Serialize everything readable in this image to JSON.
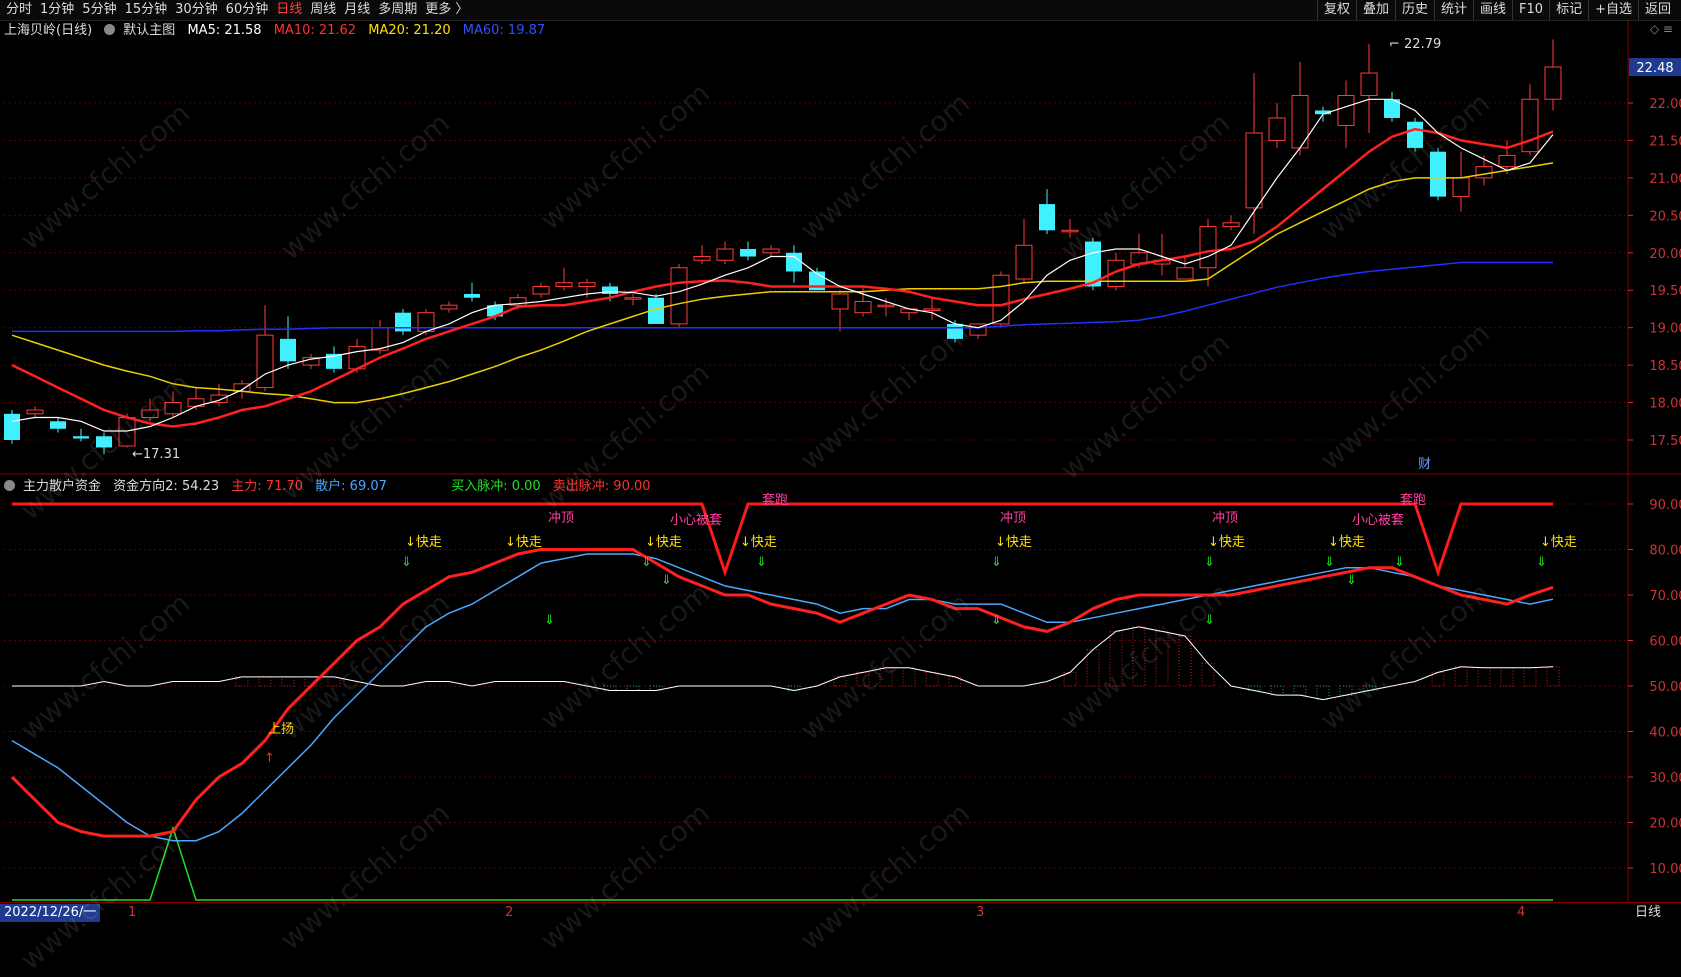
{
  "toolbar": {
    "left": [
      "分时",
      "1分钟",
      "5分钟",
      "15分钟",
      "30分钟",
      "60分钟",
      "日线",
      "周线",
      "月线",
      "多周期",
      "更多 〉"
    ],
    "active": "日线",
    "right": [
      "复权",
      "叠加",
      "历史",
      "统计",
      "画线",
      "F10",
      "标记",
      "+自选",
      "返回"
    ]
  },
  "legend_main": {
    "stock": "上海贝岭(日线)",
    "indicator": "默认主图",
    "ma5": "MA5: 21.58",
    "ma10": "MA10: 21.62",
    "ma20": "MA20: 21.20",
    "ma60": "MA60: 19.87"
  },
  "legend_sub": {
    "name": "主力散户资金",
    "dir": "资金方向2: 54.23",
    "main": "主力: 71.70",
    "retail": "散户: 69.07",
    "buy": "买入脉冲: 0.00",
    "sell": "卖出脉冲: 90.00"
  },
  "top_icons": "◇ ≡",
  "colors": {
    "up": "#ff3b3b",
    "down": "#40f0ff",
    "ma5": "#ffffff",
    "ma10": "#ff2020",
    "ma20": "#e8d000",
    "ma60": "#2030ff",
    "grid": "#5a0000",
    "axis": "#cc3333"
  },
  "price_axis": {
    "ticks": [
      "22.00",
      "21.50",
      "21.00",
      "20.50",
      "20.00",
      "19.50",
      "19.00",
      "18.50",
      "18.00",
      "17.50"
    ],
    "current": "22.48"
  },
  "sub_axis": {
    "ticks": [
      "90.00",
      "80.00",
      "70.00",
      "60.00",
      "50.00",
      "40.00",
      "30.00",
      "20.00",
      "10.00"
    ]
  },
  "annotations": {
    "high": "22.79",
    "low": "17.31",
    "fin": "财",
    "chongding": "冲顶",
    "xiaoxin": "小心被套",
    "taopao": "套跑",
    "kuaizou": "↓快走",
    "shangyang": "上扬"
  },
  "bottom": {
    "date": "2022/12/26/一",
    "months": [
      "1",
      "2",
      "3",
      "4"
    ],
    "period": "日线"
  },
  "watermark": "www.cfchi.com",
  "chart_data": {
    "type": "candlestick",
    "ylim": [
      17.2,
      22.9
    ],
    "candles": [
      [
        17.85,
        17.5,
        17.9,
        17.45
      ],
      [
        17.85,
        17.9,
        17.95,
        17.8
      ],
      [
        17.75,
        17.65,
        17.8,
        17.6
      ],
      [
        17.55,
        17.52,
        17.65,
        17.48
      ],
      [
        17.55,
        17.4,
        17.6,
        17.31
      ],
      [
        17.42,
        17.8,
        17.85,
        17.4
      ],
      [
        17.8,
        17.9,
        18.05,
        17.75
      ],
      [
        17.85,
        18.0,
        18.15,
        17.8
      ],
      [
        17.95,
        18.05,
        18.2,
        17.9
      ],
      [
        18.0,
        18.1,
        18.25,
        17.95
      ],
      [
        18.15,
        18.25,
        18.3,
        18.05
      ],
      [
        18.2,
        18.9,
        19.3,
        18.15
      ],
      [
        18.85,
        18.55,
        19.15,
        18.45
      ],
      [
        18.5,
        18.6,
        18.65,
        18.45
      ],
      [
        18.65,
        18.45,
        18.75,
        18.4
      ],
      [
        18.45,
        18.75,
        18.85,
        18.4
      ],
      [
        18.7,
        19.0,
        19.1,
        18.65
      ],
      [
        19.2,
        18.95,
        19.25,
        18.9
      ],
      [
        18.95,
        19.2,
        19.25,
        18.9
      ],
      [
        19.25,
        19.3,
        19.35,
        19.2
      ],
      [
        19.45,
        19.4,
        19.6,
        19.35
      ],
      [
        19.3,
        19.15,
        19.35,
        19.1
      ],
      [
        19.3,
        19.4,
        19.45,
        19.25
      ],
      [
        19.45,
        19.55,
        19.6,
        19.4
      ],
      [
        19.55,
        19.6,
        19.8,
        19.5
      ],
      [
        19.55,
        19.6,
        19.65,
        19.4
      ],
      [
        19.55,
        19.45,
        19.6,
        19.35
      ],
      [
        19.4,
        19.4,
        19.45,
        19.3
      ],
      [
        19.4,
        19.05,
        19.45,
        19.05
      ],
      [
        19.05,
        19.8,
        19.85,
        19.0
      ],
      [
        19.9,
        19.95,
        20.1,
        19.85
      ],
      [
        19.9,
        20.05,
        20.15,
        19.85
      ],
      [
        20.05,
        19.95,
        20.15,
        19.9
      ],
      [
        20.0,
        20.05,
        20.1,
        19.95
      ],
      [
        20.0,
        19.75,
        20.1,
        19.6
      ],
      [
        19.75,
        19.5,
        19.8,
        19.5
      ],
      [
        19.25,
        19.45,
        19.5,
        18.95
      ],
      [
        19.2,
        19.35,
        19.55,
        19.15
      ],
      [
        19.3,
        19.3,
        19.4,
        19.15
      ],
      [
        19.2,
        19.25,
        19.25,
        19.1
      ],
      [
        19.25,
        19.25,
        19.4,
        19.1
      ],
      [
        19.05,
        18.85,
        19.1,
        18.8
      ],
      [
        18.9,
        19.05,
        19.05,
        18.85
      ],
      [
        19.05,
        19.7,
        19.75,
        19.0
      ],
      [
        19.65,
        20.1,
        20.45,
        19.6
      ],
      [
        20.65,
        20.3,
        20.85,
        20.25
      ],
      [
        20.3,
        20.3,
        20.45,
        20.2
      ],
      [
        20.15,
        19.55,
        20.2,
        19.5
      ],
      [
        19.55,
        19.9,
        20.0,
        19.5
      ],
      [
        19.85,
        20.0,
        20.25,
        19.8
      ],
      [
        19.85,
        19.9,
        20.25,
        19.7
      ],
      [
        19.65,
        19.8,
        19.95,
        19.65
      ],
      [
        19.8,
        20.35,
        20.45,
        19.55
      ],
      [
        20.35,
        20.4,
        20.5,
        20.3
      ],
      [
        20.6,
        21.6,
        22.4,
        20.25
      ],
      [
        21.5,
        21.8,
        22.0,
        21.4
      ],
      [
        21.4,
        22.1,
        22.55,
        21.3
      ],
      [
        21.9,
        21.85,
        21.95,
        21.75
      ],
      [
        21.7,
        22.1,
        22.3,
        21.4
      ],
      [
        22.1,
        22.4,
        22.79,
        21.6
      ],
      [
        22.05,
        21.8,
        22.15,
        21.75
      ],
      [
        21.75,
        21.4,
        21.8,
        21.35
      ],
      [
        21.35,
        20.75,
        21.4,
        20.7
      ],
      [
        20.75,
        21.0,
        21.35,
        20.55
      ],
      [
        21.0,
        21.15,
        21.3,
        20.9
      ],
      [
        21.15,
        21.3,
        21.5,
        21.05
      ],
      [
        21.35,
        22.05,
        22.25,
        21.3
      ],
      [
        22.05,
        22.48,
        22.85,
        21.9
      ]
    ],
    "ma5": [
      17.75,
      17.8,
      17.8,
      17.75,
      17.62,
      17.62,
      17.68,
      17.8,
      17.95,
      18.03,
      18.17,
      18.38,
      18.5,
      18.58,
      18.62,
      18.68,
      18.72,
      18.8,
      18.95,
      19.05,
      19.2,
      19.3,
      19.32,
      19.35,
      19.4,
      19.45,
      19.48,
      19.47,
      19.42,
      19.48,
      19.58,
      19.7,
      19.8,
      19.95,
      19.95,
      19.72,
      19.55,
      19.45,
      19.35,
      19.25,
      19.2,
      19.05,
      19.0,
      19.1,
      19.35,
      19.7,
      19.9,
      20.0,
      20.05,
      20.05,
      19.95,
      19.85,
      19.95,
      20.1,
      20.55,
      21.0,
      21.4,
      21.85,
      21.95,
      22.05,
      22.05,
      21.9,
      21.6,
      21.4,
      21.25,
      21.1,
      21.2,
      21.58
    ],
    "ma10": [
      18.5,
      18.35,
      18.2,
      18.05,
      17.9,
      17.8,
      17.72,
      17.68,
      17.72,
      17.8,
      17.9,
      17.95,
      18.05,
      18.15,
      18.3,
      18.45,
      18.6,
      18.72,
      18.85,
      18.95,
      19.05,
      19.15,
      19.28,
      19.3,
      19.3,
      19.35,
      19.4,
      19.48,
      19.55,
      19.6,
      19.62,
      19.63,
      19.6,
      19.55,
      19.55,
      19.55,
      19.55,
      19.55,
      19.52,
      19.48,
      19.4,
      19.35,
      19.3,
      19.3,
      19.38,
      19.45,
      19.52,
      19.6,
      19.75,
      19.85,
      19.9,
      19.95,
      20.02,
      20.05,
      20.15,
      20.35,
      20.6,
      20.85,
      21.1,
      21.35,
      21.55,
      21.65,
      21.6,
      21.5,
      21.45,
      21.4,
      21.5,
      21.62
    ],
    "ma20": [
      18.9,
      18.8,
      18.7,
      18.6,
      18.5,
      18.42,
      18.35,
      18.25,
      18.2,
      18.18,
      18.15,
      18.12,
      18.1,
      18.05,
      18.0,
      18.0,
      18.05,
      18.12,
      18.2,
      18.28,
      18.38,
      18.48,
      18.6,
      18.7,
      18.82,
      18.95,
      19.05,
      19.15,
      19.25,
      19.32,
      19.38,
      19.42,
      19.45,
      19.48,
      19.48,
      19.48,
      19.48,
      19.48,
      19.5,
      19.52,
      19.52,
      19.52,
      19.52,
      19.55,
      19.6,
      19.62,
      19.62,
      19.62,
      19.62,
      19.62,
      19.62,
      19.62,
      19.65,
      19.85,
      20.05,
      20.25,
      20.4,
      20.55,
      20.7,
      20.85,
      20.95,
      21.0,
      21.0,
      21.0,
      21.05,
      21.1,
      21.15,
      21.2
    ],
    "ma60": [
      18.95,
      18.95,
      18.95,
      18.95,
      18.95,
      18.95,
      18.95,
      18.95,
      18.96,
      18.96,
      18.97,
      18.98,
      18.98,
      18.99,
      19.0,
      19.0,
      19.0,
      19.0,
      19.0,
      19.0,
      19.0,
      19.0,
      19.0,
      19.0,
      19.0,
      19.0,
      19.0,
      19.0,
      19.0,
      19.0,
      19.0,
      19.0,
      19.0,
      19.0,
      19.0,
      19.0,
      19.0,
      19.0,
      19.0,
      19.0,
      19.0,
      19.0,
      19.0,
      19.02,
      19.04,
      19.05,
      19.06,
      19.07,
      19.08,
      19.1,
      19.15,
      19.22,
      19.3,
      19.38,
      19.46,
      19.54,
      19.6,
      19.66,
      19.71,
      19.75,
      19.78,
      19.81,
      19.84,
      19.87,
      19.87,
      19.87,
      19.87,
      19.87
    ],
    "sub_ylim": [
      0,
      100
    ],
    "main_line": [
      30,
      25,
      20,
      18,
      17,
      17,
      17,
      18,
      25,
      30,
      33,
      38,
      45,
      50,
      55,
      60,
      63,
      68,
      71,
      74,
      75,
      77,
      79,
      80,
      80,
      80,
      80,
      80,
      77,
      74,
      72,
      70,
      70,
      68,
      67,
      66,
      64,
      66,
      68,
      70,
      69,
      67,
      67,
      65,
      63,
      62,
      64,
      67,
      69,
      70,
      70,
      70,
      70,
      70,
      71,
      72,
      73,
      74,
      75,
      76,
      76,
      74,
      72,
      70,
      69,
      68,
      70,
      71.7
    ],
    "retail_line": [
      38,
      35,
      32,
      28,
      24,
      20,
      17,
      16,
      16,
      18,
      22,
      27,
      32,
      37,
      43,
      48,
      53,
      58,
      63,
      66,
      68,
      71,
      74,
      77,
      78,
      79,
      79,
      79,
      78,
      76,
      74,
      72,
      71,
      70,
      69,
      68,
      66,
      67,
      67,
      69,
      69,
      68,
      68,
      68,
      66,
      64,
      64,
      65,
      66,
      67,
      68,
      69,
      70,
      71,
      72,
      73,
      74,
      75,
      76,
      76,
      75,
      74,
      72,
      71,
      70,
      69,
      68,
      69.07
    ],
    "dir2": [
      50,
      50,
      50,
      50,
      51,
      50,
      50,
      51,
      51,
      51,
      52,
      52,
      52,
      52,
      52,
      51,
      50,
      50,
      51,
      51,
      50,
      51,
      51,
      51,
      51,
      50,
      49,
      49,
      49,
      50,
      50,
      50,
      50,
      50,
      49,
      50,
      52,
      53,
      54,
      54,
      53,
      52,
      50,
      50,
      50,
      51,
      53,
      58,
      62,
      63,
      62,
      61,
      55,
      50,
      49,
      48,
      48,
      47,
      48,
      49,
      50,
      51,
      53,
      54.23,
      54,
      54,
      54,
      54.23
    ],
    "buy_pulse": [
      0,
      0,
      0,
      0,
      0,
      0,
      0,
      20,
      0,
      0,
      0,
      0,
      0,
      0,
      0,
      0,
      0,
      0,
      0,
      0,
      0,
      0,
      0,
      0,
      0,
      0,
      0,
      0,
      0,
      0,
      0,
      0,
      0,
      0,
      0,
      0,
      0,
      0,
      0,
      0,
      0,
      0,
      0,
      0,
      0,
      0,
      0,
      0,
      0,
      0,
      0,
      0,
      0,
      0,
      0,
      0,
      0,
      0,
      0,
      0,
      0,
      0,
      0,
      0,
      0,
      0,
      0,
      0
    ],
    "sell_pulse": [
      90,
      90,
      90,
      90,
      90,
      90,
      90,
      90,
      90,
      90,
      90,
      90,
      90,
      90,
      90,
      90,
      90,
      90,
      90,
      90,
      90,
      90,
      90,
      90,
      90,
      90,
      90,
      90,
      90,
      90,
      90,
      75,
      90,
      90,
      90,
      90,
      90,
      90,
      90,
      90,
      90,
      90,
      90,
      90,
      90,
      90,
      90,
      90,
      90,
      90,
      90,
      90,
      90,
      90,
      90,
      90,
      90,
      90,
      90,
      90,
      90,
      90,
      75,
      90,
      90,
      90,
      90,
      90
    ]
  }
}
